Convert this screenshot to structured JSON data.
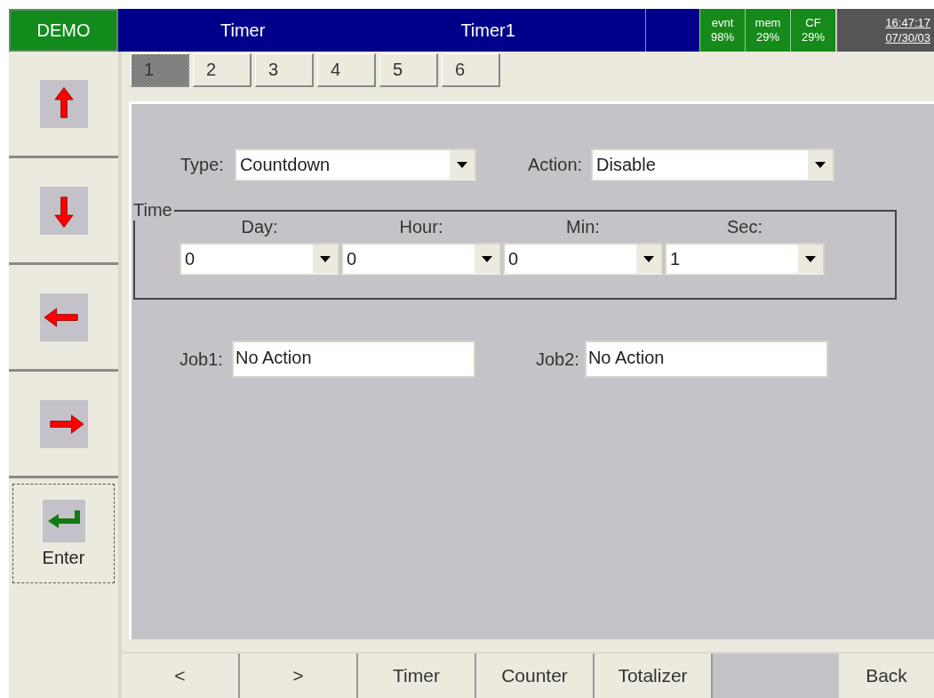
{
  "header": {
    "badge": "DEMO",
    "title": "Timer",
    "subtitle": "Timer1",
    "status": [
      {
        "label": "evnt",
        "value": "98%"
      },
      {
        "label": "mem",
        "value": "29%"
      },
      {
        "label": "CF",
        "value": "29%"
      }
    ],
    "time": "16:47:17",
    "date": "07/30/03"
  },
  "sidebar": {
    "buttons": [
      {
        "kind": "up",
        "focused": false
      },
      {
        "kind": "down",
        "focused": false
      },
      {
        "kind": "left",
        "focused": false
      },
      {
        "kind": "right",
        "focused": false
      },
      {
        "kind": "enter",
        "label": "Enter",
        "focused": true
      }
    ]
  },
  "tabs": [
    {
      "label": "1",
      "selected": true
    },
    {
      "label": "2",
      "selected": false
    },
    {
      "label": "3",
      "selected": false
    },
    {
      "label": "4",
      "selected": false
    },
    {
      "label": "5",
      "selected": false
    },
    {
      "label": "6",
      "selected": false
    }
  ],
  "form": {
    "type": {
      "label": "Type:",
      "value": "Countdown"
    },
    "action": {
      "label": "Action:",
      "value": "Disable"
    },
    "time": {
      "legend": "Time",
      "fields": [
        {
          "label": "Day:",
          "value": "0"
        },
        {
          "label": "Hour:",
          "value": "0"
        },
        {
          "label": "Min:",
          "value": "0"
        },
        {
          "label": "Sec:",
          "value": "1"
        }
      ]
    },
    "job1": {
      "label": "Job1:",
      "value": "No Action"
    },
    "job2": {
      "label": "Job2:",
      "value": "No Action"
    }
  },
  "bottom_bar": {
    "left": [
      "<",
      ">",
      "Timer",
      "Counter",
      "Totalizer"
    ],
    "right": [
      "Back"
    ]
  }
}
